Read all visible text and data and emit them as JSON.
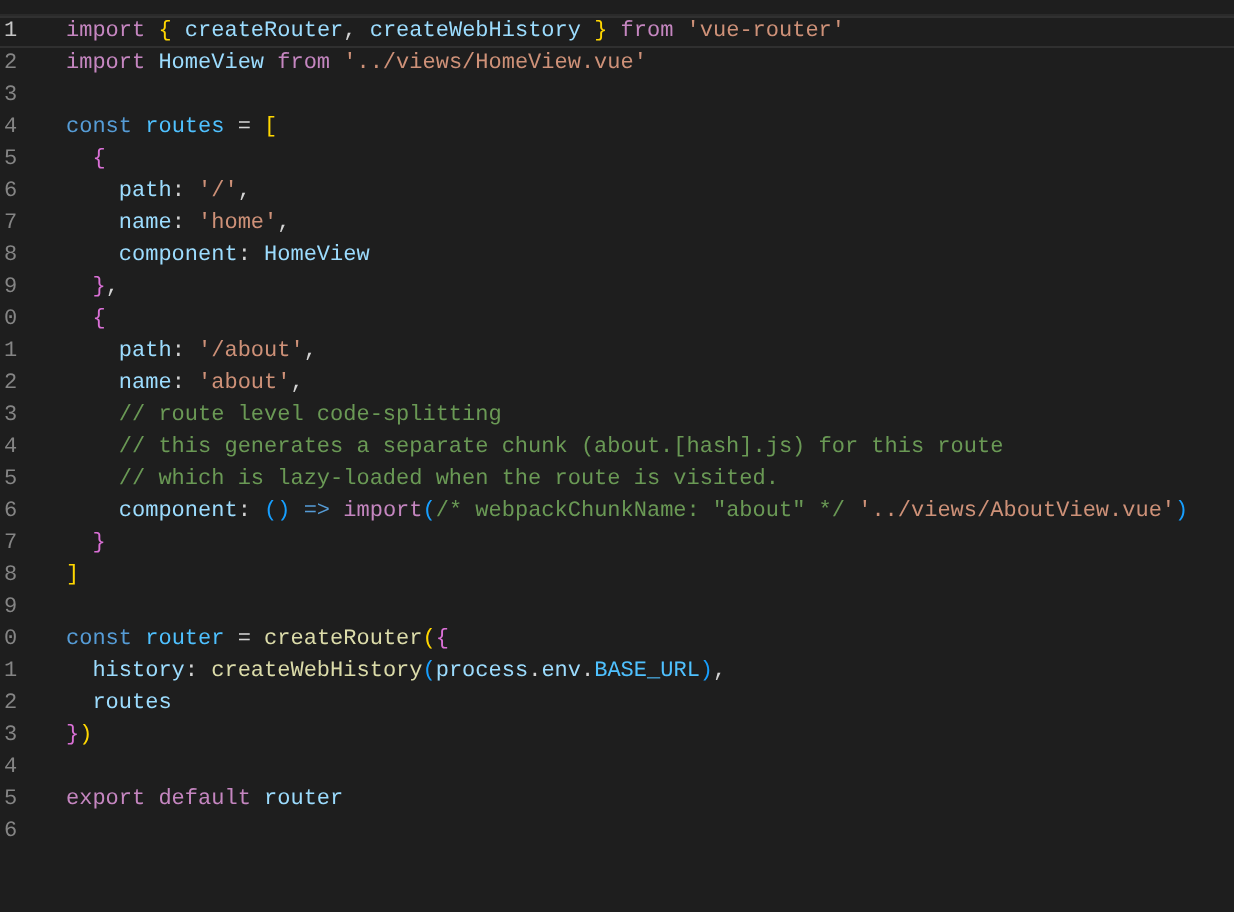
{
  "editor": {
    "lines": [
      {
        "number": "1",
        "active": true,
        "tokens": [
          {
            "text": "import ",
            "color": "#c586c0"
          },
          {
            "text": "{",
            "color": "#ffd700"
          },
          {
            "text": " createRouter",
            "color": "#9cdcfe"
          },
          {
            "text": ", ",
            "color": "#d4d4d4"
          },
          {
            "text": "createWebHistory ",
            "color": "#9cdcfe"
          },
          {
            "text": "}",
            "color": "#ffd700"
          },
          {
            "text": " from ",
            "color": "#c586c0"
          },
          {
            "text": "'vue-router'",
            "color": "#ce9178"
          }
        ]
      },
      {
        "number": "2",
        "active": false,
        "tokens": [
          {
            "text": "import",
            "color": "#c586c0"
          },
          {
            "text": " HomeView ",
            "color": "#9cdcfe"
          },
          {
            "text": "from",
            "color": "#c586c0"
          },
          {
            "text": " '../views/HomeView.vue'",
            "color": "#ce9178"
          }
        ]
      },
      {
        "number": "3",
        "active": false
      },
      {
        "number": "4",
        "active": false,
        "tokens": [
          {
            "text": "const",
            "color": "#569cd6"
          },
          {
            "text": " routes",
            "color": "#4fc1ff"
          },
          {
            "text": " = ",
            "color": "#d4d4d4"
          },
          {
            "text": "[",
            "color": "#ffd700"
          }
        ]
      },
      {
        "number": "5",
        "active": false,
        "tokens": [
          {
            "text": "  {",
            "color": "#da70d6"
          }
        ]
      },
      {
        "number": "6",
        "active": false,
        "tokens": [
          {
            "text": "    path",
            "color": "#9cdcfe"
          },
          {
            "text": ": ",
            "color": "#d4d4d4"
          },
          {
            "text": "'/'",
            "color": "#ce9178"
          },
          {
            "text": ",",
            "color": "#d4d4d4"
          }
        ]
      },
      {
        "number": "7",
        "active": false,
        "tokens": [
          {
            "text": "    name",
            "color": "#9cdcfe"
          },
          {
            "text": ": ",
            "color": "#d4d4d4"
          },
          {
            "text": "'home'",
            "color": "#ce9178"
          },
          {
            "text": ",",
            "color": "#d4d4d4"
          }
        ]
      },
      {
        "number": "8",
        "active": false,
        "tokens": [
          {
            "text": "    component",
            "color": "#9cdcfe"
          },
          {
            "text": ": ",
            "color": "#d4d4d4"
          },
          {
            "text": "HomeView",
            "color": "#9cdcfe"
          }
        ]
      },
      {
        "number": "9",
        "active": false,
        "tokens": [
          {
            "text": "  }",
            "color": "#da70d6"
          },
          {
            "text": ",",
            "color": "#d4d4d4"
          }
        ]
      },
      {
        "number": "0",
        "active": false,
        "tokens": [
          {
            "text": "  {",
            "color": "#da70d6"
          }
        ]
      },
      {
        "number": "1",
        "active": false,
        "tokens": [
          {
            "text": "    path",
            "color": "#9cdcfe"
          },
          {
            "text": ": ",
            "color": "#d4d4d4"
          },
          {
            "text": "'/about'",
            "color": "#ce9178"
          },
          {
            "text": ",",
            "color": "#d4d4d4"
          }
        ]
      },
      {
        "number": "2",
        "active": false,
        "tokens": [
          {
            "text": "    name",
            "color": "#9cdcfe"
          },
          {
            "text": ": ",
            "color": "#d4d4d4"
          },
          {
            "text": "'about'",
            "color": "#ce9178"
          },
          {
            "text": ",",
            "color": "#d4d4d4"
          }
        ]
      },
      {
        "number": "3",
        "active": false,
        "tokens": [
          {
            "text": "    // route level code-splitting",
            "color": "#6a9955"
          }
        ]
      },
      {
        "number": "4",
        "active": false,
        "tokens": [
          {
            "text": "    // this generates a separate chunk (about.[hash].js) for this route",
            "color": "#6a9955"
          }
        ]
      },
      {
        "number": "5",
        "active": false,
        "tokens": [
          {
            "text": "    // which is lazy-loaded when the route is visited.",
            "color": "#6a9955"
          }
        ]
      },
      {
        "number": "6",
        "active": false,
        "tokens": [
          {
            "text": "    component",
            "color": "#9cdcfe"
          },
          {
            "text": ": ",
            "color": "#d4d4d4"
          },
          {
            "text": "()",
            "color": "#179fff"
          },
          {
            "text": " => ",
            "color": "#569cd6"
          },
          {
            "text": "import",
            "color": "#c586c0"
          },
          {
            "text": "(",
            "color": "#179fff"
          },
          {
            "text": "/* webpackChunkName: \"about\" */",
            "color": "#6a9955"
          },
          {
            "text": " '../views/AboutView.vue'",
            "color": "#ce9178"
          },
          {
            "text": ")",
            "color": "#179fff"
          }
        ]
      },
      {
        "number": "7",
        "active": false,
        "tokens": [
          {
            "text": "  }",
            "color": "#da70d6"
          }
        ]
      },
      {
        "number": "8",
        "active": false,
        "tokens": [
          {
            "text": "]",
            "color": "#ffd700"
          }
        ]
      },
      {
        "number": "9",
        "active": false
      },
      {
        "number": "0",
        "active": false,
        "tokens": [
          {
            "text": "const",
            "color": "#569cd6"
          },
          {
            "text": " router",
            "color": "#4fc1ff"
          },
          {
            "text": " = ",
            "color": "#d4d4d4"
          },
          {
            "text": "createRouter",
            "color": "#dcdcaa"
          },
          {
            "text": "(",
            "color": "#ffd700"
          },
          {
            "text": "{",
            "color": "#da70d6"
          }
        ]
      },
      {
        "number": "1",
        "active": false,
        "tokens": [
          {
            "text": "  history",
            "color": "#9cdcfe"
          },
          {
            "text": ": ",
            "color": "#d4d4d4"
          },
          {
            "text": "createWebHistory",
            "color": "#dcdcaa"
          },
          {
            "text": "(",
            "color": "#179fff"
          },
          {
            "text": "process",
            "color": "#9cdcfe"
          },
          {
            "text": ".",
            "color": "#d4d4d4"
          },
          {
            "text": "env",
            "color": "#9cdcfe"
          },
          {
            "text": ".",
            "color": "#d4d4d4"
          },
          {
            "text": "BASE_URL",
            "color": "#4fc1ff"
          },
          {
            "text": ")",
            "color": "#179fff"
          },
          {
            "text": ",",
            "color": "#d4d4d4"
          }
        ]
      },
      {
        "number": "2",
        "active": false,
        "tokens": [
          {
            "text": "  routes",
            "color": "#9cdcfe"
          }
        ]
      },
      {
        "number": "3",
        "active": false,
        "tokens": [
          {
            "text": "}",
            "color": "#da70d6"
          },
          {
            "text": ")",
            "color": "#ffd700"
          }
        ]
      },
      {
        "number": "4",
        "active": false
      },
      {
        "number": "5",
        "active": false,
        "tokens": [
          {
            "text": "export default",
            "color": "#c586c0"
          },
          {
            "text": " router",
            "color": "#9cdcfe"
          }
        ]
      },
      {
        "number": "6",
        "active": false
      }
    ]
  }
}
